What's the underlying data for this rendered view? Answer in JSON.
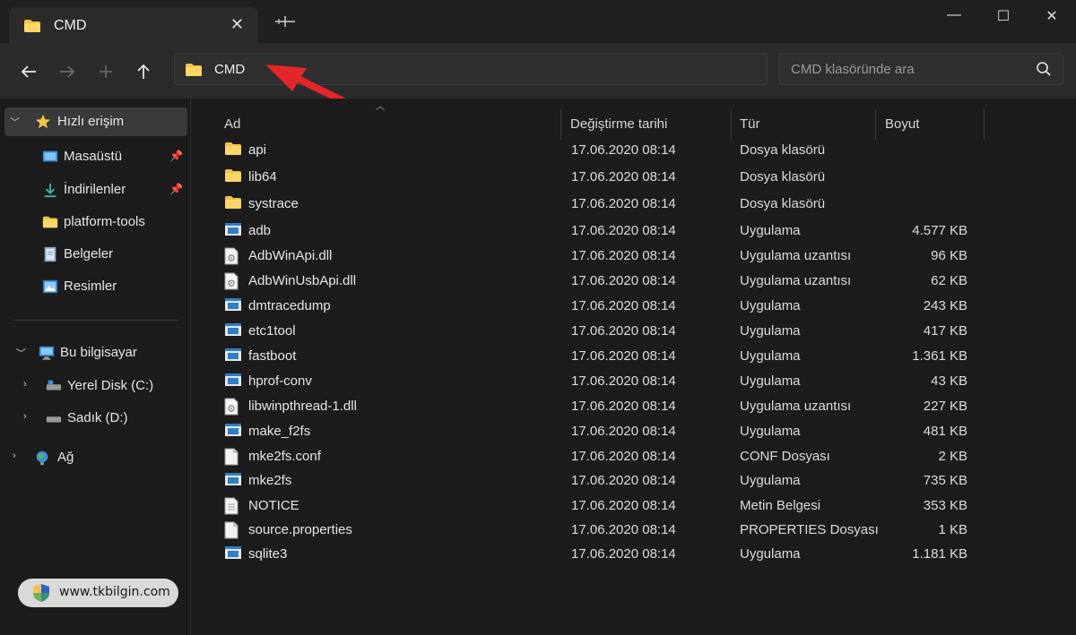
{
  "window": {
    "tab_title": "CMD",
    "tab_close": "✕",
    "minimize": "—",
    "maximize": "☐",
    "close": "✕"
  },
  "toolbar": {
    "address_text": "CMD",
    "search_placeholder": "CMD klasöründe ara"
  },
  "sidebar": {
    "items": [
      {
        "label": "Hızlı erişim",
        "icon": "star-icon"
      },
      {
        "label": "Masaüstü",
        "icon": "desktop-icon"
      },
      {
        "label": "İndirilenler",
        "icon": "download-icon"
      },
      {
        "label": "platform-tools",
        "icon": "folder-icon"
      },
      {
        "label": "Belgeler",
        "icon": "document-icon"
      },
      {
        "label": "Resimler",
        "icon": "pictures-icon"
      },
      {
        "label": "Bu bilgisayar",
        "icon": "computer-icon"
      },
      {
        "label": "Yerel Disk (C:)",
        "icon": "drive-icon"
      },
      {
        "label": "Sadık (D:)",
        "icon": "drive-icon"
      },
      {
        "label": "Ağ",
        "icon": "network-icon"
      }
    ]
  },
  "columns": {
    "name": "Ad",
    "date": "Değiştirme tarihi",
    "type": "Tür",
    "size": "Boyut"
  },
  "files": [
    {
      "name": "api",
      "date": "17.06.2020 08:14",
      "type": "Dosya klasörü",
      "size": "",
      "icon": "folder-icon"
    },
    {
      "name": "lib64",
      "date": "17.06.2020 08:14",
      "type": "Dosya klasörü",
      "size": "",
      "icon": "folder-icon"
    },
    {
      "name": "systrace",
      "date": "17.06.2020 08:14",
      "type": "Dosya klasörü",
      "size": "",
      "icon": "folder-icon"
    },
    {
      "name": "adb",
      "date": "17.06.2020 08:14",
      "type": "Uygulama",
      "size": "4.577 KB",
      "icon": "app-icon"
    },
    {
      "name": "AdbWinApi.dll",
      "date": "17.06.2020 08:14",
      "type": "Uygulama uzantısı",
      "size": "96 KB",
      "icon": "dll-icon"
    },
    {
      "name": "AdbWinUsbApi.dll",
      "date": "17.06.2020 08:14",
      "type": "Uygulama uzantısı",
      "size": "62 KB",
      "icon": "dll-icon"
    },
    {
      "name": "dmtracedump",
      "date": "17.06.2020 08:14",
      "type": "Uygulama",
      "size": "243 KB",
      "icon": "app-icon"
    },
    {
      "name": "etc1tool",
      "date": "17.06.2020 08:14",
      "type": "Uygulama",
      "size": "417 KB",
      "icon": "app-icon"
    },
    {
      "name": "fastboot",
      "date": "17.06.2020 08:14",
      "type": "Uygulama",
      "size": "1.361 KB",
      "icon": "app-icon"
    },
    {
      "name": "hprof-conv",
      "date": "17.06.2020 08:14",
      "type": "Uygulama",
      "size": "43 KB",
      "icon": "app-icon"
    },
    {
      "name": "libwinpthread-1.dll",
      "date": "17.06.2020 08:14",
      "type": "Uygulama uzantısı",
      "size": "227 KB",
      "icon": "dll-icon"
    },
    {
      "name": "make_f2fs",
      "date": "17.06.2020 08:14",
      "type": "Uygulama",
      "size": "481 KB",
      "icon": "app-icon"
    },
    {
      "name": "mke2fs.conf",
      "date": "17.06.2020 08:14",
      "type": "CONF Dosyası",
      "size": "2 KB",
      "icon": "file-icon"
    },
    {
      "name": "mke2fs",
      "date": "17.06.2020 08:14",
      "type": "Uygulama",
      "size": "735 KB",
      "icon": "app-icon"
    },
    {
      "name": "NOTICE",
      "date": "17.06.2020 08:14",
      "type": "Metin Belgesi",
      "size": "353 KB",
      "icon": "text-file-icon"
    },
    {
      "name": "source.properties",
      "date": "17.06.2020 08:14",
      "type": "PROPERTIES Dosyası",
      "size": "1 KB",
      "icon": "file-icon"
    },
    {
      "name": "sqlite3",
      "date": "17.06.2020 08:14",
      "type": "Uygulama",
      "size": "1.181 KB",
      "icon": "app-icon"
    }
  ],
  "watermark": {
    "text": "www.tkbilgin.com"
  },
  "colors": {
    "background": "#1c1c1c",
    "toolbar": "#2b2b2b",
    "folder": "#f2c14e",
    "selected": "#3a3a3a",
    "annotation_arrow": "#e3262a"
  }
}
